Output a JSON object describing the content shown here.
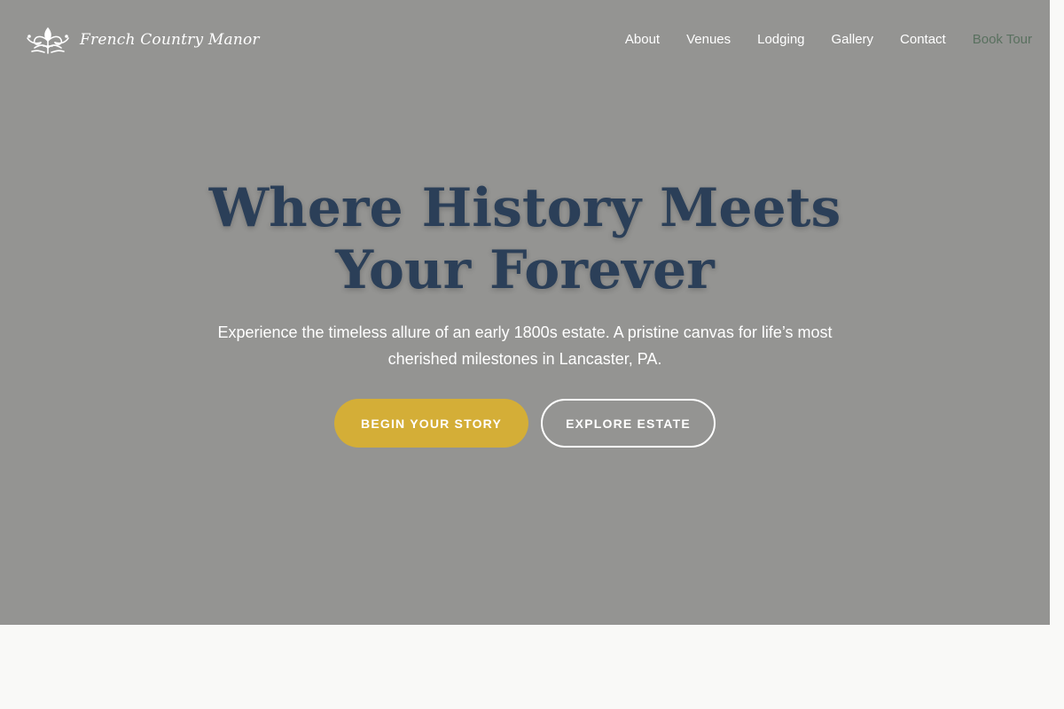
{
  "brand": {
    "name": "French Country Manor",
    "logo_icon": "fleur-de-lis-ornament-icon"
  },
  "nav": {
    "items": [
      {
        "label": "About"
      },
      {
        "label": "Venues"
      },
      {
        "label": "Lodging"
      },
      {
        "label": "Gallery"
      },
      {
        "label": "Contact"
      },
      {
        "label": "Book Tour"
      }
    ]
  },
  "hero": {
    "headline_line1": "Where History Meets",
    "headline_line2": "Your Forever",
    "subtitle": "Experience the timeless allure of an early 1800s estate. A pristine canvas for life’s most cherished milestones in Lancaster, PA.",
    "primary_button": "BEGIN YOUR STORY",
    "secondary_button": "EXPLORE ESTATE"
  },
  "colors": {
    "hero_overlay": "#949492",
    "headline": "#2b3f58",
    "accent_gold": "#d4ae37",
    "cta_nav": "#59705f",
    "page_background": "#f9f9f7"
  }
}
